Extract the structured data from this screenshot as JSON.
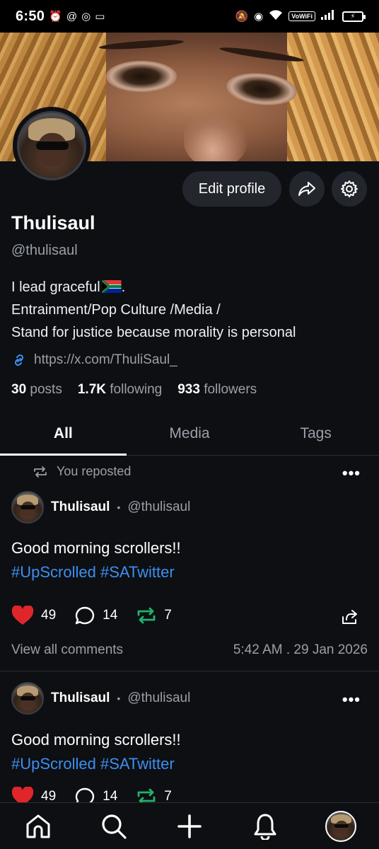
{
  "status_bar": {
    "time": "6:50",
    "network_label": "VoWiFi"
  },
  "profile": {
    "name": "Thulisaul",
    "handle": "@thulisaul",
    "bio_lines": [
      "I lead graceful",
      "Entrainment/Pop Culture /Media /",
      "Stand for justice because morality is personal"
    ],
    "link": "https://x.com/ThuliSaul_",
    "edit_label": "Edit profile",
    "stats": {
      "posts_count": "30",
      "posts_label": "posts",
      "following_count": "1.7K",
      "following_label": "following",
      "followers_count": "933",
      "followers_label": "followers"
    }
  },
  "tabs": [
    {
      "label": "All",
      "active": true
    },
    {
      "label": "Media",
      "active": false
    },
    {
      "label": "Tags",
      "active": false
    }
  ],
  "posts": [
    {
      "repost_label": "You reposted",
      "author": "Thulisaul",
      "handle": "@thulisaul",
      "text": "Good morning scrollers!!",
      "hashtags": "#UpScrolled #SATwitter",
      "likes": "49",
      "comments": "14",
      "reposts": "7",
      "view_comments": "View all comments",
      "timestamp": "5:42 AM . 29 Jan 2026"
    },
    {
      "author": "Thulisaul",
      "handle": "@thulisaul",
      "text": "Good morning scrollers!!",
      "hashtags": "#UpScrolled #SATwitter",
      "likes": "49",
      "comments": "14",
      "reposts": "7"
    }
  ],
  "colors": {
    "background": "#0d0f13",
    "accent_link": "#3d8ff0",
    "like_red": "#e0262b",
    "repost_green": "#1fb36a",
    "muted_text": "#9aa0a8"
  },
  "icons": {
    "nav": [
      "home-icon",
      "search-icon",
      "plus-icon",
      "bell-icon",
      "profile-avatar"
    ]
  }
}
